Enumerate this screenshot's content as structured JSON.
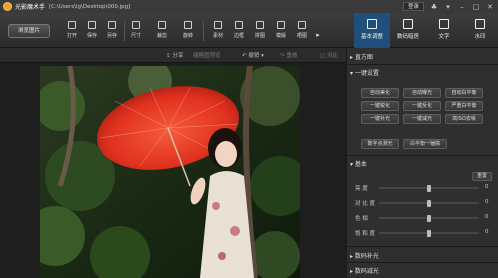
{
  "app": {
    "title": "光影魔术手",
    "file_path": "[C:\\Users\\lg\\Desktop\\000.jpg]"
  },
  "titlebar": {
    "login_label": "登录"
  },
  "toolbar": {
    "browse_label": "浏览图片",
    "tools": [
      "打开",
      "保存",
      "另存",
      "尺寸",
      "裁剪",
      "旋转",
      "素材",
      "边框",
      "拼图",
      "模版",
      "晒图"
    ]
  },
  "tabs": [
    "基本调整",
    "数码暗房",
    "文字",
    "水印"
  ],
  "subbar": {
    "share": "分享",
    "tab_preview": "缩略图预览",
    "undo": "撤销",
    "redo": "重做",
    "compare": "对比"
  },
  "panel": {
    "histogram": "直方图",
    "oneclick": "一键设置",
    "oneclick_buttons": [
      "自动美化",
      "自动曝光",
      "自动白平衡",
      "一键锐化",
      "一键反化",
      "严重白平衡",
      "一键补光",
      "一键减光",
      "高ISO去噪",
      "数字点测光",
      "白平衡一锤搞"
    ],
    "basic": "基本",
    "reset": "重置",
    "sliders": [
      {
        "label": "亮 度",
        "value": 0
      },
      {
        "label": "对 比 度",
        "value": 0
      },
      {
        "label": "色 相",
        "value": 0
      },
      {
        "label": "饱 和 度",
        "value": 0
      }
    ],
    "digital_fill": "数码补光",
    "digital_reduce": "数码减光"
  }
}
